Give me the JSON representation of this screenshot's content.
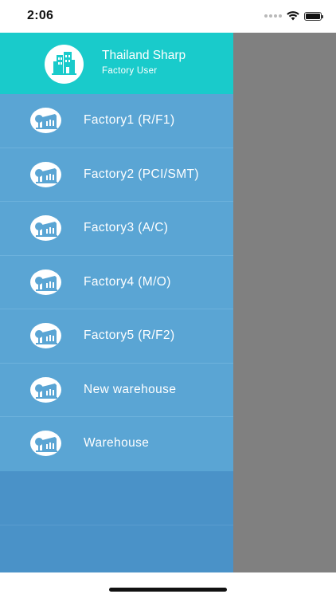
{
  "status_bar": {
    "time": "2:06",
    "icons": [
      "signal-dots-icon",
      "wifi-icon",
      "battery-icon"
    ]
  },
  "drawer": {
    "header": {
      "logo_icon": "building-icon",
      "title": "Thailand Sharp",
      "subtitle": "Factory User"
    },
    "items": [
      {
        "label": "Factory1 (R/F1)",
        "icon": "factory-icon"
      },
      {
        "label": "Factory2 (PCI/SMT)",
        "icon": "factory-icon"
      },
      {
        "label": "Factory3 (A/C)",
        "icon": "factory-icon"
      },
      {
        "label": "Factory4 (M/O)",
        "icon": "factory-icon"
      },
      {
        "label": "Factory5 (R/F2)",
        "icon": "factory-icon"
      },
      {
        "label": "New warehouse",
        "icon": "factory-icon"
      },
      {
        "label": "Warehouse",
        "icon": "factory-icon"
      }
    ]
  },
  "colors": {
    "header_bg": "#19cbcb",
    "menu_bg": "#5aa5d4",
    "drawer_bottom_bg": "#4a92c8",
    "overlay": "#808080",
    "icon_color": "#5aa5d4"
  }
}
